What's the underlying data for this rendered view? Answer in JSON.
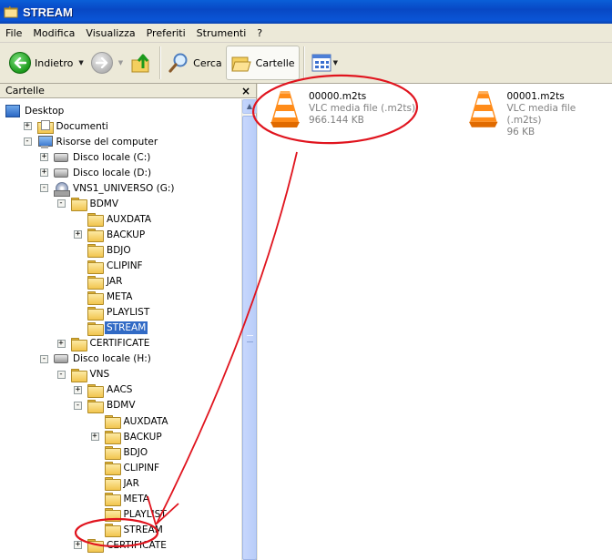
{
  "window": {
    "title": "STREAM"
  },
  "menu": [
    "File",
    "Modifica",
    "Visualizza",
    "Preferiti",
    "Strumenti",
    "?"
  ],
  "toolbar": {
    "back_label": "Indietro",
    "search_label": "Cerca",
    "folders_label": "Cartelle"
  },
  "folders_pane": {
    "title": "Cartelle",
    "close_glyph": "×"
  },
  "tree": [
    {
      "label": "Desktop",
      "icon": "desktop-icon",
      "expander": ""
    },
    {
      "label": "Documenti",
      "icon": "documents-folder-icon",
      "expander": "+"
    },
    {
      "label": "Risorse del computer",
      "icon": "computer-icon",
      "expander": "−"
    },
    {
      "label": "Disco locale (C:)",
      "icon": "drive-icon",
      "expander": "+"
    },
    {
      "label": "Disco locale (D:)",
      "icon": "drive-icon",
      "expander": "+"
    },
    {
      "label": "VNS1_UNIVERSO (G:)",
      "icon": "cd-drive-icon",
      "expander": "−"
    },
    {
      "label": "BDMV",
      "icon": "folder-icon",
      "expander": "−"
    },
    {
      "label": "AUXDATA",
      "icon": "folder-icon",
      "expander": ""
    },
    {
      "label": "BACKUP",
      "icon": "folder-icon",
      "expander": "+"
    },
    {
      "label": "BDJO",
      "icon": "folder-icon",
      "expander": ""
    },
    {
      "label": "CLIPINF",
      "icon": "folder-icon",
      "expander": ""
    },
    {
      "label": "JAR",
      "icon": "folder-icon",
      "expander": ""
    },
    {
      "label": "META",
      "icon": "folder-icon",
      "expander": ""
    },
    {
      "label": "PLAYLIST",
      "icon": "folder-icon",
      "expander": ""
    },
    {
      "label": "STREAM",
      "icon": "folder-icon",
      "expander": "",
      "selected": true
    },
    {
      "label": "CERTIFICATE",
      "icon": "folder-icon",
      "expander": "+"
    },
    {
      "label": "Disco locale (H:)",
      "icon": "drive-icon",
      "expander": "−"
    },
    {
      "label": "VNS",
      "icon": "folder-icon",
      "expander": "−"
    },
    {
      "label": "AACS",
      "icon": "folder-icon",
      "expander": "+"
    },
    {
      "label": "BDMV",
      "icon": "folder-icon",
      "expander": "−"
    },
    {
      "label": "AUXDATA",
      "icon": "folder-icon",
      "expander": ""
    },
    {
      "label": "BACKUP",
      "icon": "folder-icon",
      "expander": "+"
    },
    {
      "label": "BDJO",
      "icon": "folder-icon",
      "expander": ""
    },
    {
      "label": "CLIPINF",
      "icon": "folder-icon",
      "expander": ""
    },
    {
      "label": "JAR",
      "icon": "folder-icon",
      "expander": ""
    },
    {
      "label": "META",
      "icon": "folder-icon",
      "expander": ""
    },
    {
      "label": "PLAYLIST",
      "icon": "folder-icon",
      "expander": ""
    },
    {
      "label": "STREAM",
      "icon": "folder-icon",
      "expander": ""
    },
    {
      "label": "CERTIFICATE",
      "icon": "folder-icon",
      "expander": "+"
    }
  ],
  "files": [
    {
      "name": "00000.m2ts",
      "type": "VLC media file (.m2ts)",
      "size": "966.144 KB",
      "icon": "vlc-icon"
    },
    {
      "name": "00001.m2ts",
      "type": "VLC media file (.m2ts)",
      "size": "96 KB",
      "icon": "vlc-icon"
    }
  ],
  "colors": {
    "titlebar": "#0a55d6",
    "selection": "#316ac5",
    "annotation_red": "#e0141e"
  }
}
